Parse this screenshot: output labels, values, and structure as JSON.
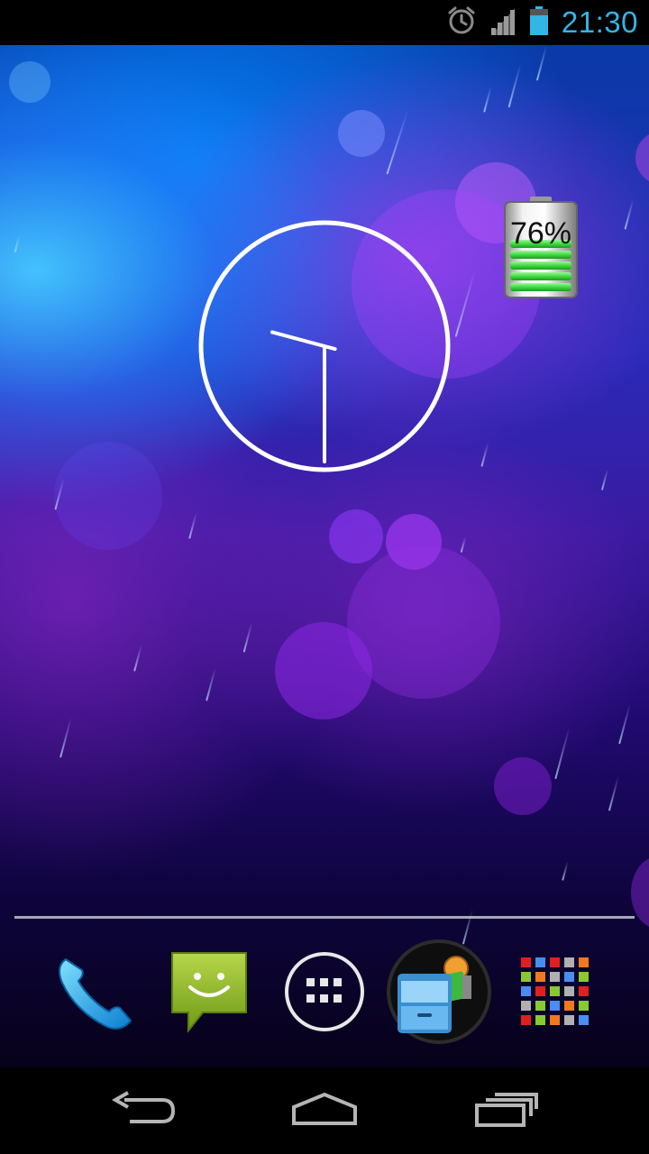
{
  "status_bar": {
    "time": "21:30",
    "icons": [
      "alarm-icon",
      "signal-icon",
      "battery-icon"
    ],
    "accent_color": "#33b5e5"
  },
  "home": {
    "clock_widget": {
      "hour": 21,
      "minute": 30
    },
    "battery_widget": {
      "percent_label": "76%",
      "level": 0.76,
      "fill_color": "#3ddc3d"
    }
  },
  "dock": {
    "items": [
      {
        "name": "phone",
        "icon": "phone-icon"
      },
      {
        "name": "messaging",
        "icon": "messaging-icon"
      },
      {
        "name": "all-apps",
        "icon": "app-drawer-icon"
      },
      {
        "name": "folder",
        "icon": "file-manager-icon"
      },
      {
        "name": "apps-grid",
        "icon": "color-grid-icon"
      }
    ]
  },
  "nav_bar": {
    "buttons": [
      "back-icon",
      "home-icon",
      "recents-icon"
    ]
  }
}
